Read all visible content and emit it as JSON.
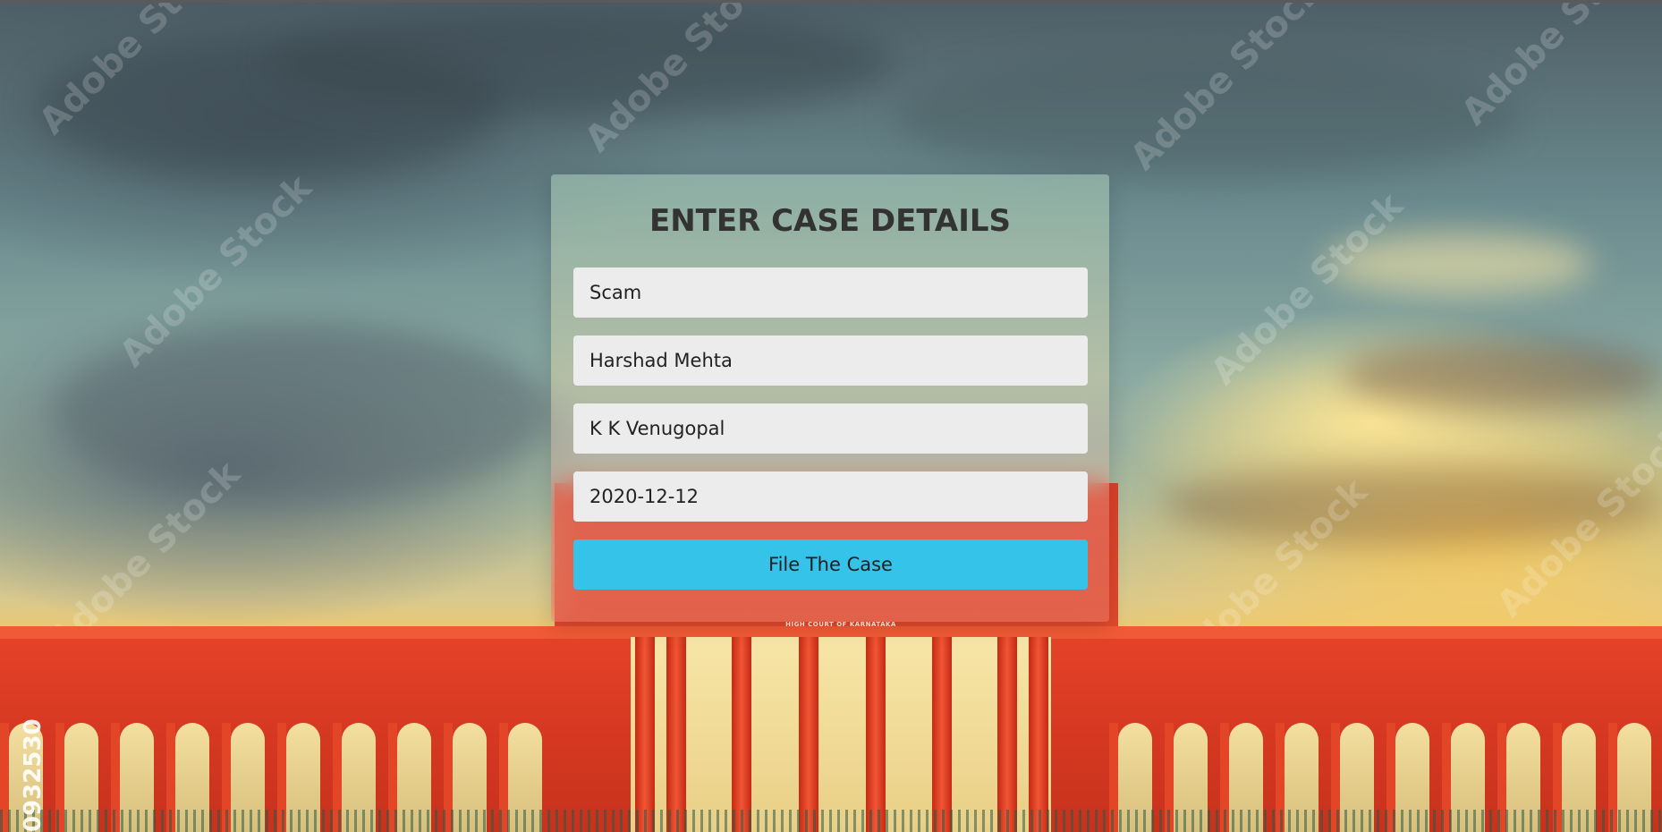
{
  "form": {
    "title": "ENTER CASE DETAILS",
    "fields": [
      {
        "value": "Scam"
      },
      {
        "value": "Harshad Mehta"
      },
      {
        "value": "K K Venugopal"
      },
      {
        "value": "2020-12-12"
      }
    ],
    "submit_label": "File The Case",
    "submit_color": "#36c3ea"
  },
  "background": {
    "building_label": "HIGH COURT OF KARNATAKA",
    "watermark_text": "Adobe Stock",
    "stock_id": "0932530"
  }
}
